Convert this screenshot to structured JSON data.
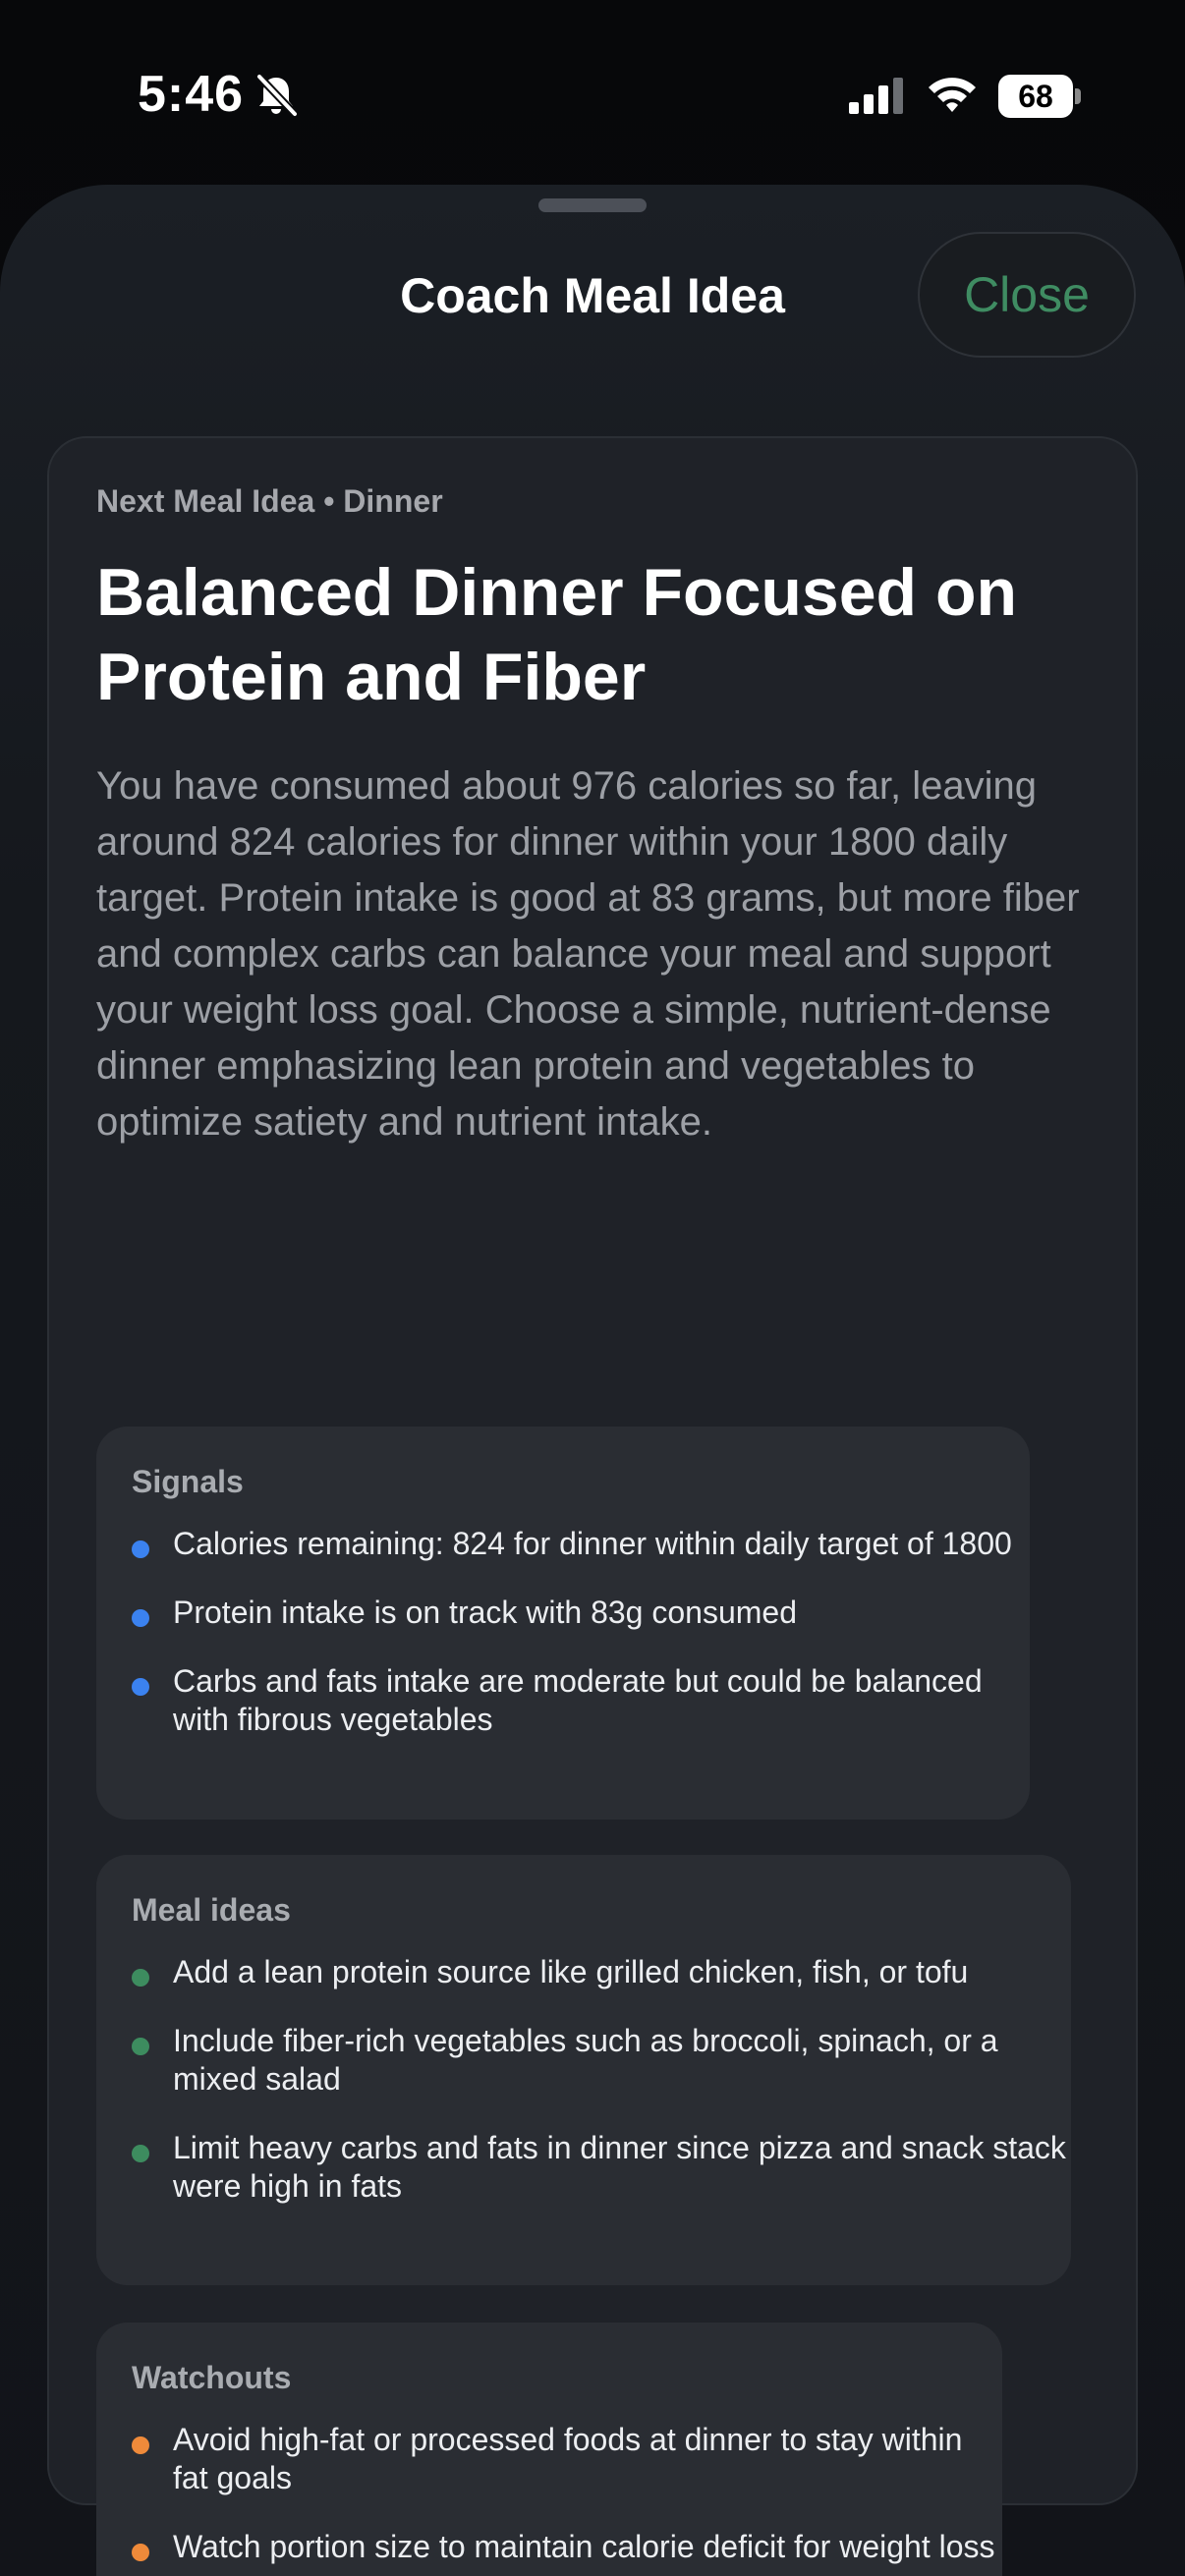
{
  "status_bar": {
    "time": "5:46",
    "battery_level": "68",
    "icons": [
      "bell-slash-icon",
      "cellular-signal-icon",
      "wifi-icon",
      "battery-icon"
    ]
  },
  "sheet": {
    "title": "Coach Meal Idea",
    "close_label": "Close",
    "accent_color": "#3f8c62"
  },
  "card": {
    "eyebrow": "Next Meal Idea • Dinner",
    "headline": "Balanced Dinner Focused on Protein and Fiber",
    "summary": "You have consumed about 976 calories so far, leaving around 824 calories for dinner within your 1800 daily target. Protein intake is good at 83 grams, but more fiber and complex carbs can balance your meal and support your weight loss goal. Choose a simple, nutrient-dense dinner emphasizing lean protein and vegetables to optimize satiety and nutrient intake."
  },
  "signals": {
    "title": "Signals",
    "color": "#3b82f0",
    "items": [
      "Calories remaining: 824 for dinner within daily target of 1800",
      "Protein intake is on track with 83g consumed",
      "Carbs and fats intake are moderate but could be balanced with fibrous vegetables"
    ]
  },
  "meal_ideas": {
    "title": "Meal ideas",
    "color": "#3d8c5f",
    "items": [
      "Add a lean protein source like grilled chicken, fish, or tofu",
      "Include fiber-rich vegetables such as broccoli, spinach, or a mixed salad",
      "Limit heavy carbs and fats in dinner since pizza and snack stack were high in fats"
    ]
  },
  "watchouts": {
    "title": "Watchouts",
    "color": "#ef8a3a",
    "items": [
      "Avoid high-fat or processed foods at dinner to stay within fat goals",
      "Watch portion size to maintain calorie deficit for weight loss"
    ]
  }
}
